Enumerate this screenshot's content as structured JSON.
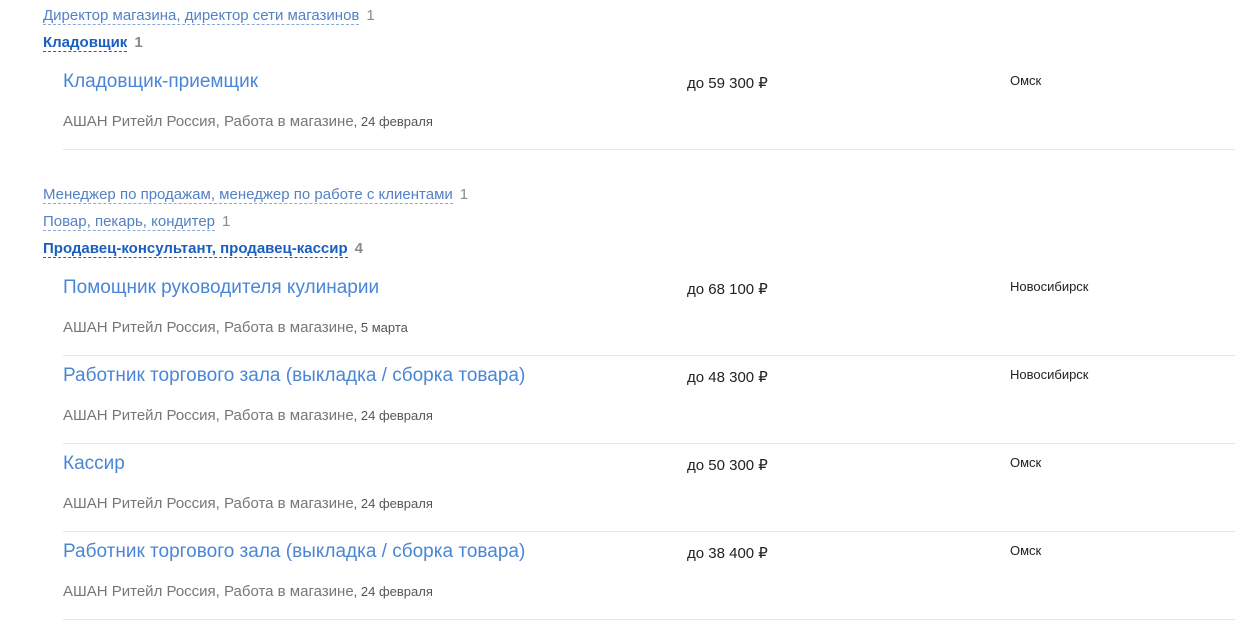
{
  "categories_top": [
    {
      "label": "Директор магазина, директор сети магазинов",
      "count": "1"
    },
    {
      "label": "Кладовщик",
      "count": "1"
    }
  ],
  "group1_vacancies": [
    {
      "title": "Кладовщик-приемщик",
      "salary": "до 59 300 ₽",
      "city": "Омск",
      "company": "АШАН Ритейл Россия, Работа в магазине",
      "date": ", 24 февраля"
    }
  ],
  "categories_middle": [
    {
      "label": "Менеджер по продажам, менеджер по работе с клиентами",
      "count": "1"
    },
    {
      "label": "Повар, пекарь, кондитер",
      "count": "1"
    },
    {
      "label": "Продавец-консультант, продавец-кассир",
      "count": "4"
    }
  ],
  "group2_vacancies": [
    {
      "title": "Помощник руководителя кулинарии",
      "salary": "до 68 100 ₽",
      "city": "Новосибирск",
      "company": "АШАН Ритейл Россия, Работа в магазине",
      "date": ", 5 марта"
    },
    {
      "title": "Работник торгового зала (выкладка / сборка товара)",
      "salary": "до 48 300 ₽",
      "city": "Новосибирск",
      "company": "АШАН Ритейл Россия, Работа в магазине",
      "date": ", 24 февраля"
    },
    {
      "title": "Кассир",
      "salary": "до 50 300 ₽",
      "city": "Омск",
      "company": "АШАН Ритейл Россия, Работа в магазине",
      "date": ", 24 февраля"
    },
    {
      "title": "Работник торгового зала (выкладка / сборка товара)",
      "salary": "до 38 400 ₽",
      "city": "Омск",
      "company": "АШАН Ритейл Россия, Работа в магазине",
      "date": ", 24 февраля"
    }
  ]
}
